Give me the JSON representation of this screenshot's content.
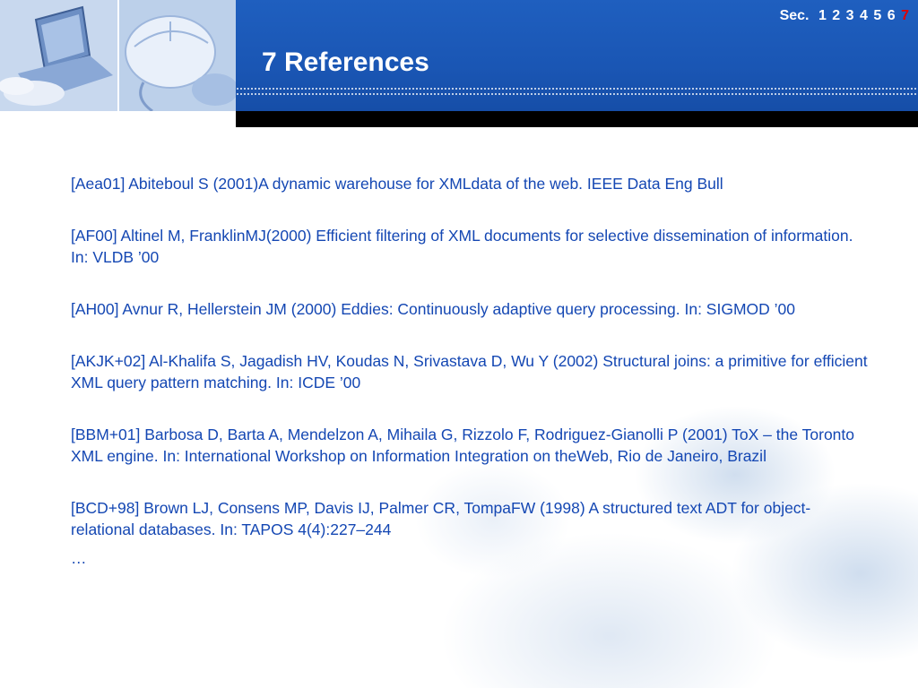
{
  "header": {
    "title": "7 References",
    "nav": {
      "prefix": "Sec.",
      "sections": [
        "1",
        "2",
        "3",
        "4",
        "5",
        "6",
        "7"
      ],
      "active": "7",
      "active_color": "#e00000"
    }
  },
  "colors": {
    "header_blue": "#1a56b4",
    "text_blue": "#1447b3"
  },
  "references": [
    "[Aea01] Abiteboul S (2001)A dynamic warehouse for XMLdata of the web. IEEE Data Eng Bull",
    "[AF00] Altinel M, FranklinMJ(2000) Efficient filtering of XML documents for selective dissemination of information. In: VLDB ’00",
    "[AH00] Avnur R, Hellerstein JM (2000) Eddies: Continuously adaptive query processing. In: SIGMOD ’00",
    "[AKJK+02] Al-Khalifa S, Jagadish HV, Koudas N, Srivastava D, Wu Y (2002) Structural joins: a primitive for efficient XML query pattern matching. In: ICDE ’00",
    "[BBM+01] Barbosa D, Barta A, Mendelzon A, Mihaila G, Rizzolo F, Rodriguez-Gianolli P (2001) ToX – the Toronto XML engine. In: International Workshop on Information Integration on theWeb, Rio de Janeiro, Brazil",
    "[BCD+98] Brown LJ, Consens MP, Davis IJ, Palmer CR, TompaFW (1998) A structured text ADT for object-relational databases. In: TAPOS 4(4):227–244"
  ],
  "ellipsis": "…",
  "decorations": {
    "header_photo_left": "laptop-typing-photo",
    "header_photo_right": "computer-mouse-photo",
    "background": "business-people-watermark"
  }
}
